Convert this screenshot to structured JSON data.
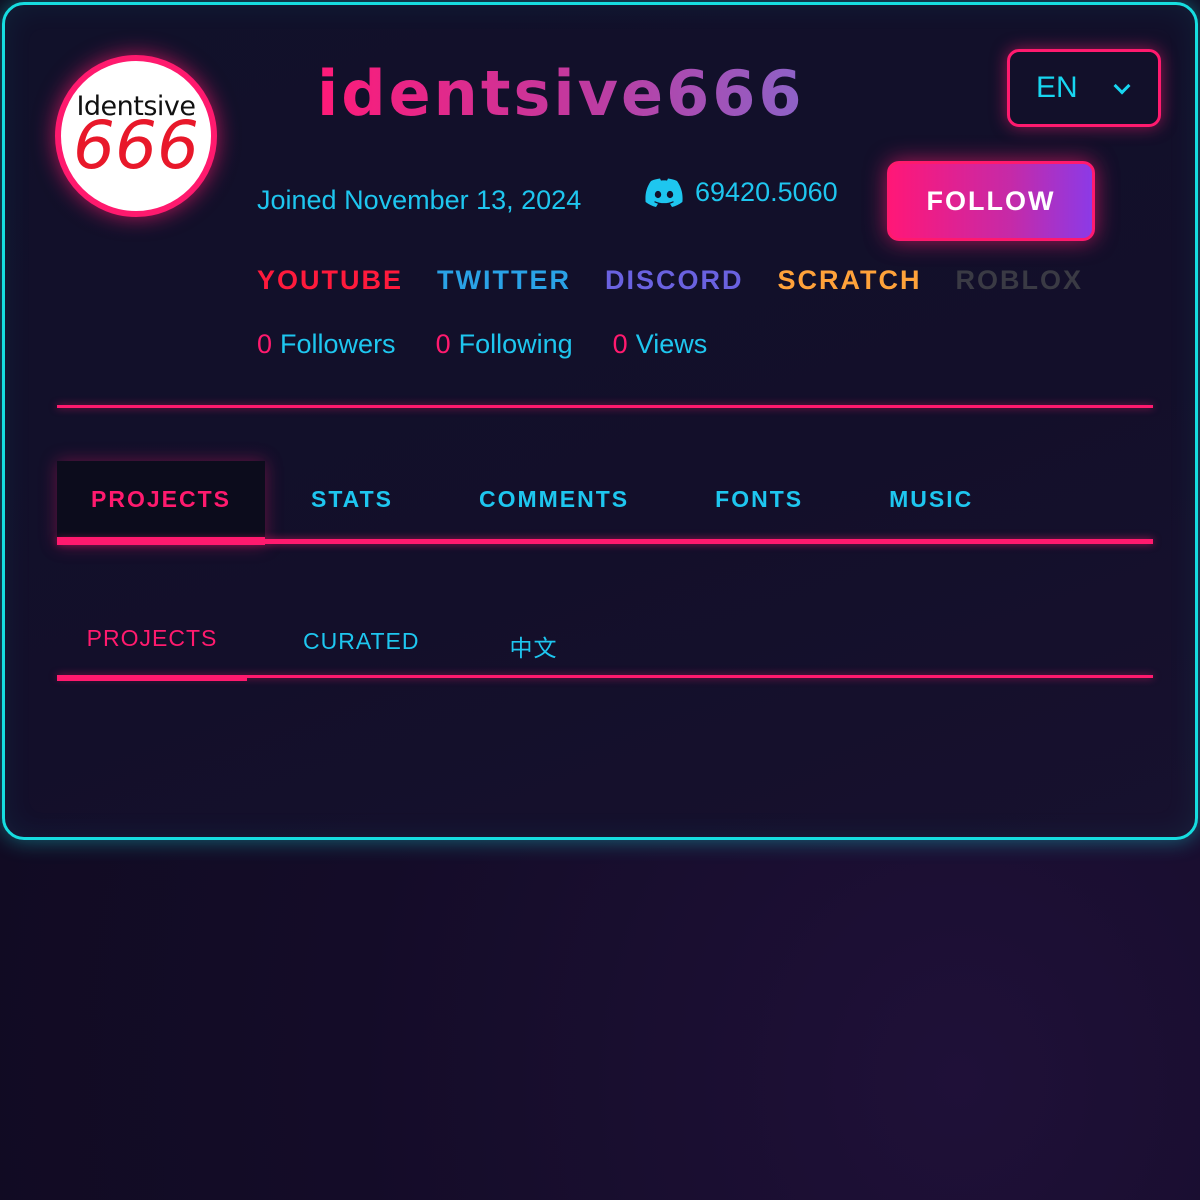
{
  "profile": {
    "avatar_top_text": "Identsive",
    "avatar_number": "666",
    "username": "identsive666",
    "joined": "Joined November 13, 2024",
    "discord_id": "69420.5060",
    "follow_label": "FOLLOW"
  },
  "language": {
    "selected": "EN"
  },
  "socials": [
    {
      "label": "YOUTUBE",
      "color": "#ff1a3c"
    },
    {
      "label": "TWITTER",
      "color": "#2aa2e6"
    },
    {
      "label": "DISCORD",
      "color": "#6a62e0"
    },
    {
      "label": "SCRATCH",
      "color": "#ffa23a"
    },
    {
      "label": "ROBLOX",
      "color": "#3a3a44"
    }
  ],
  "stats": [
    {
      "count": "0",
      "label": "Followers"
    },
    {
      "count": "0",
      "label": "Following"
    },
    {
      "count": "0",
      "label": "Views"
    }
  ],
  "tabs": [
    "PROJECTS",
    "STATS",
    "COMMENTS",
    "FONTS",
    "MUSIC"
  ],
  "subtabs": [
    "PROJECTS",
    "CURATED",
    "中文"
  ],
  "colors": {
    "accent": "#ff1a6e",
    "cyan": "#16dde0",
    "text": "#1ec6ef"
  }
}
